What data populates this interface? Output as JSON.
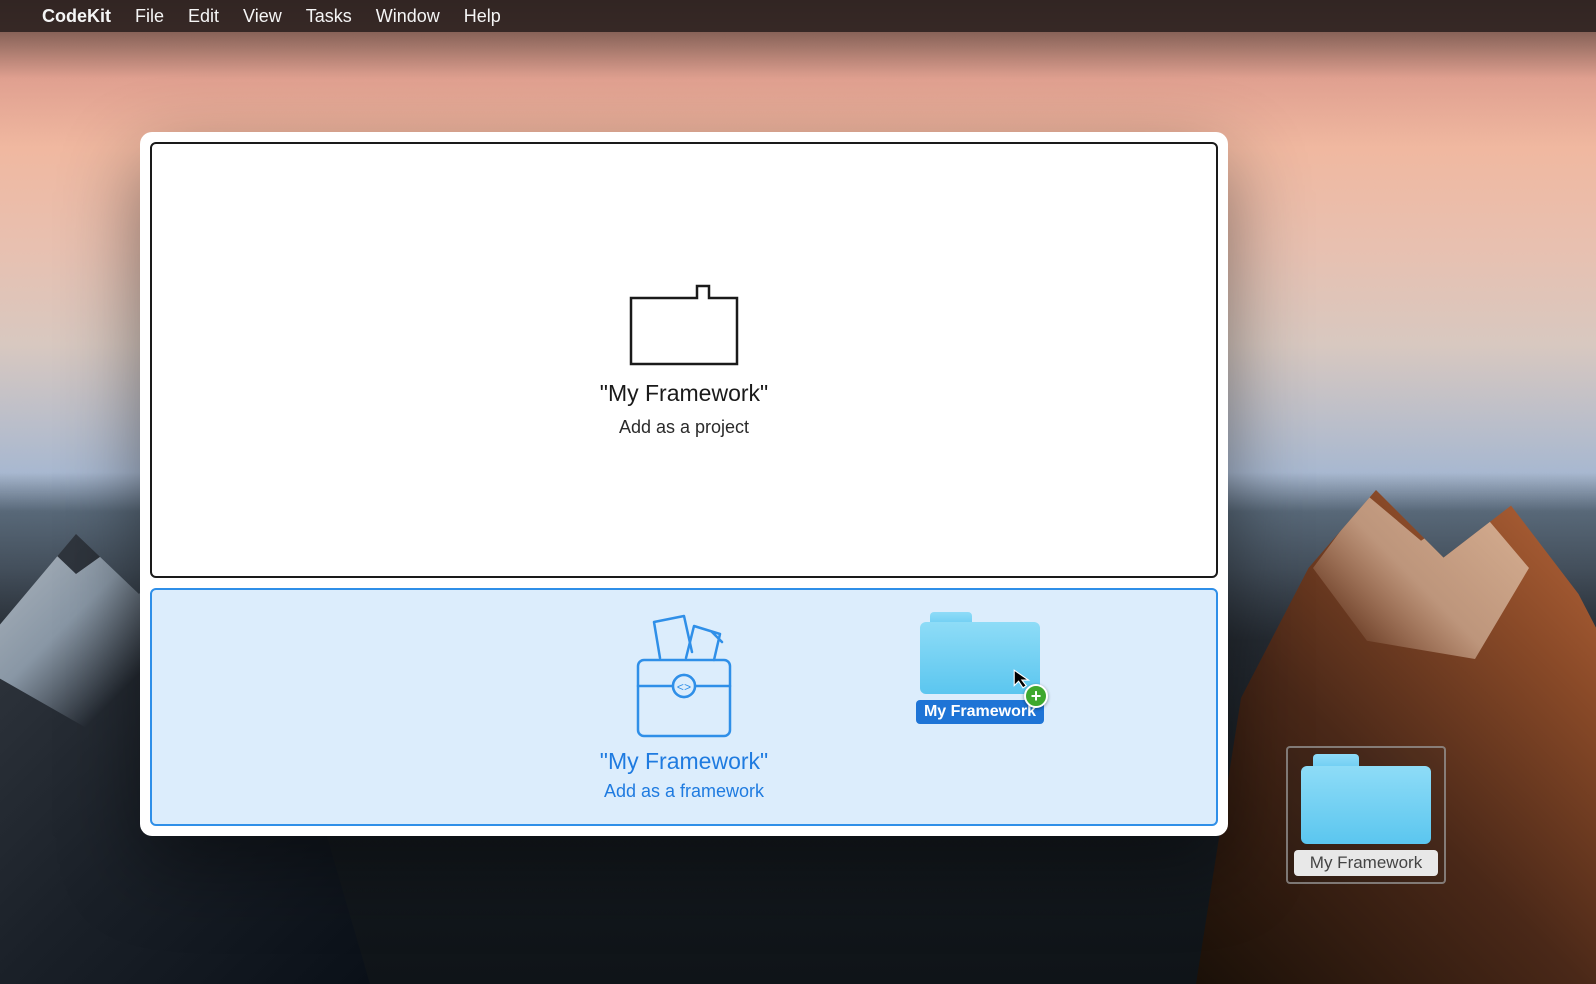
{
  "menubar": {
    "app_name": "CodeKit",
    "items": [
      "File",
      "Edit",
      "View",
      "Tasks",
      "Window",
      "Help"
    ]
  },
  "window": {
    "project_zone": {
      "title": "\"My Framework\"",
      "subtitle": "Add as a project"
    },
    "framework_zone": {
      "title": "\"My Framework\"",
      "subtitle": "Add as a framework"
    },
    "dragged_item_label": "My Framework"
  },
  "desktop": {
    "item_label": "My Framework"
  }
}
